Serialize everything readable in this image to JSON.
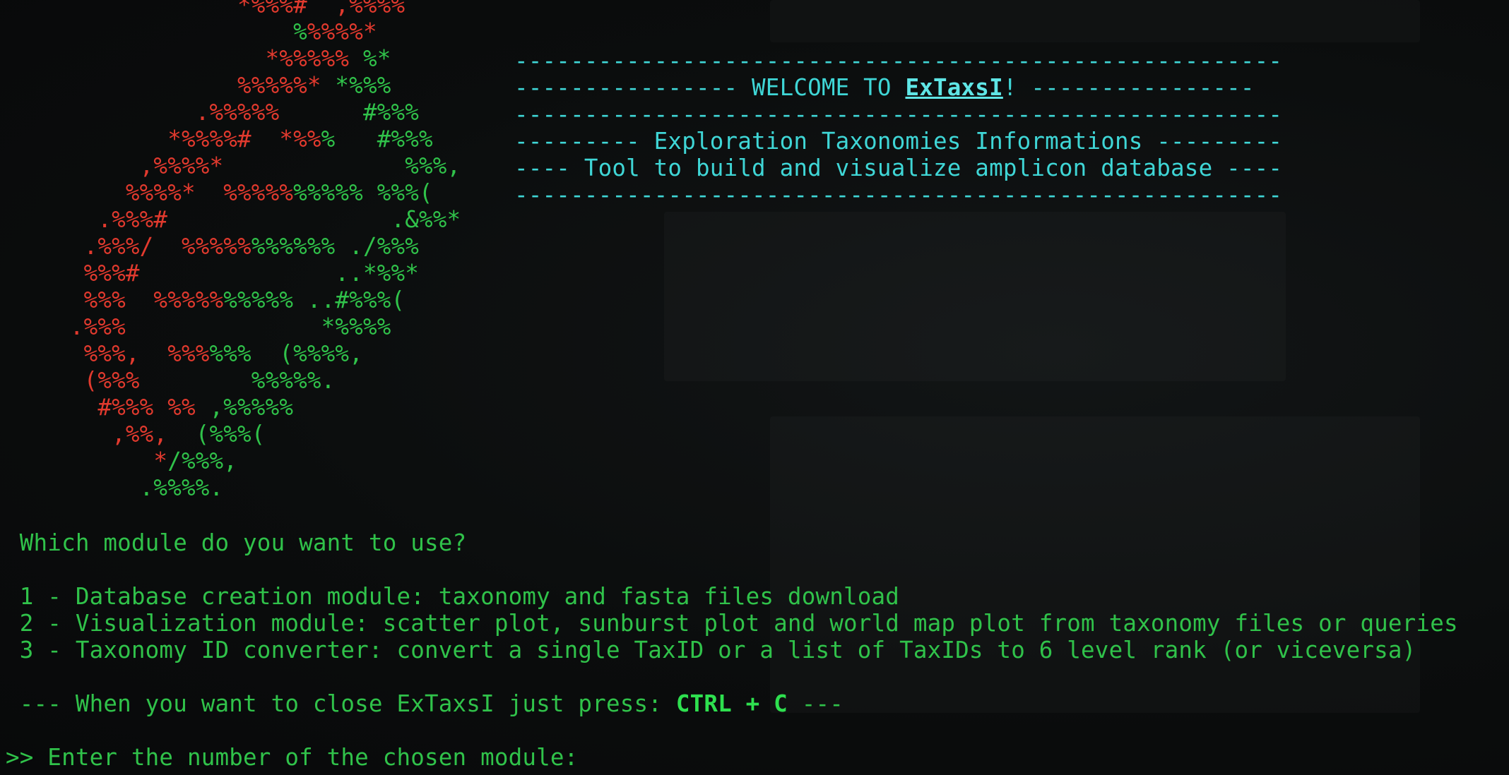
{
  "logo_lines": [
    [
      {
        "c": "r",
        "t": "                 *%%%#  ,%%%%"
      }
    ],
    [
      {
        "c": "r",
        "t": "                     "
      },
      {
        "c": "g",
        "t": "%"
      },
      {
        "c": "r",
        "t": "%%%%*"
      }
    ],
    [
      {
        "c": "r",
        "t": "                   *%%%%% "
      },
      {
        "c": "g",
        "t": "%*"
      }
    ],
    [
      {
        "c": "r",
        "t": "                 %%%%%* "
      },
      {
        "c": "g",
        "t": "*%%%"
      }
    ],
    [
      {
        "c": "r",
        "t": "              .%%%%%      "
      },
      {
        "c": "g",
        "t": "#%%%"
      }
    ],
    [
      {
        "c": "r",
        "t": "            *%%%%#  *%%"
      },
      {
        "c": "g",
        "t": "%   #%%%"
      }
    ],
    [
      {
        "c": "r",
        "t": "          ,%%%%*"
      },
      {
        "c": "g",
        "t": "             %%%,"
      }
    ],
    [
      {
        "c": "r",
        "t": "         %%%%*  %%%%%"
      },
      {
        "c": "g",
        "t": "%%%%% %%%("
      }
    ],
    [
      {
        "c": "r",
        "t": "       .%%%#"
      },
      {
        "c": "g",
        "t": "                .&%%*"
      }
    ],
    [
      {
        "c": "r",
        "t": "      .%%%/  %%%%%"
      },
      {
        "c": "g",
        "t": "%%%%%% ./%%%"
      }
    ],
    [
      {
        "c": "r",
        "t": "      %%%#"
      },
      {
        "c": "g",
        "t": "              ..*%%*"
      }
    ],
    [
      {
        "c": "r",
        "t": "      %%%  %%%%%"
      },
      {
        "c": "g",
        "t": "%%%%% ..#%%%("
      }
    ],
    [
      {
        "c": "r",
        "t": "     .%%%"
      },
      {
        "c": "g",
        "t": "              *%%%%"
      }
    ],
    [
      {
        "c": "r",
        "t": "      %%%,  %%%"
      },
      {
        "c": "g",
        "t": "%%%  (%%%%,"
      }
    ],
    [
      {
        "c": "r",
        "t": "      (%%%"
      },
      {
        "c": "g",
        "t": "        %%%%%."
      }
    ],
    [
      {
        "c": "r",
        "t": "       #%%% %%"
      },
      {
        "c": "g",
        "t": " ,%%%%%"
      }
    ],
    [
      {
        "c": "r",
        "t": "        ,%%,"
      },
      {
        "c": "g",
        "t": "  (%%%("
      }
    ],
    [
      {
        "c": "r",
        "t": "           *"
      },
      {
        "c": "g",
        "t": "/%%%,"
      }
    ],
    [
      {
        "c": "g",
        "t": "          .%%%%."
      }
    ]
  ],
  "banner": {
    "line1": "-------------------------------------------------------",
    "line2_pre": "---------------- WELCOME TO ",
    "brand": "ExTaxsI",
    "line2_post": "! ----------------",
    "line3": "-------------------------------------------------------",
    "line4": "--------- Exploration Taxonomies Informations ---------",
    "line5": "---- Tool to build and visualize amplicon database ----",
    "line6": "-------------------------------------------------------"
  },
  "prompt": {
    "question": " Which module do you want to use?",
    "option1": " 1 - Database creation module: taxonomy and fasta files download",
    "option2": " 2 - Visualization module: scatter plot, sunburst plot and world map plot from taxonomy files or queries",
    "option3": " 3 - Taxonomy ID converter: convert a single TaxID or a list of TaxIDs to 6 level rank (or viceversa)",
    "close_pre": " --- When you want to close ExTaxsI just press: ",
    "close_keys": "CTRL + C",
    "close_post": " ---",
    "input_prompt": ">> Enter the number of the chosen module:"
  },
  "colors": {
    "green": "#30c24a",
    "red": "#e23a2e",
    "cyan": "#3fd6d6",
    "background": "#0b0d0d"
  }
}
